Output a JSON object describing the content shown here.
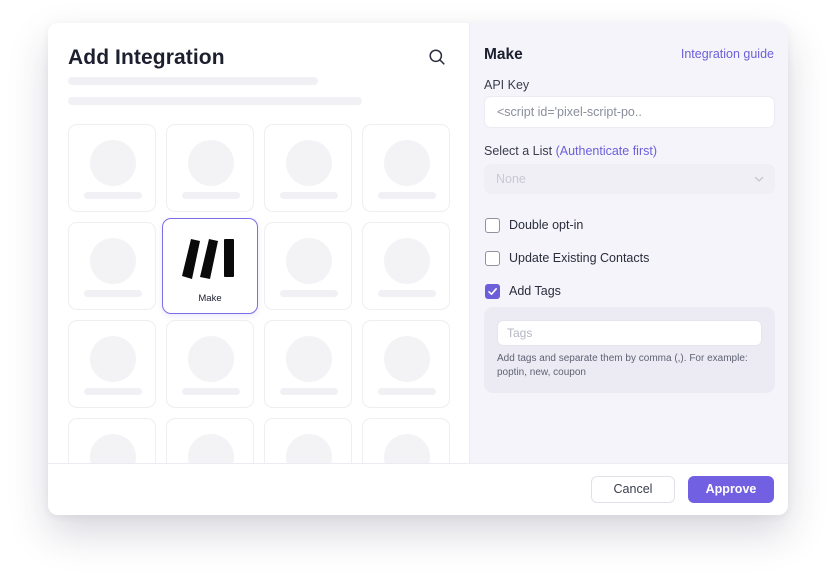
{
  "left_pane": {
    "title": "Add Integration",
    "icons": {
      "search": "search-icon"
    },
    "selected_card": {
      "label": "Make",
      "icon": "make-logo-icon"
    }
  },
  "right_pane": {
    "title": "Make",
    "guide_link": "Integration guide",
    "api_key": {
      "label": "API Key",
      "value": "<script id='pixel-script-po.."
    },
    "list": {
      "label": "Select a List",
      "hint": "(Authenticate first)",
      "selected": "None",
      "icon": "chevron-down-icon"
    },
    "checkboxes": [
      {
        "label": "Double opt-in",
        "checked": false
      },
      {
        "label": "Update Existing Contacts",
        "checked": false
      },
      {
        "label": "Add Tags",
        "checked": true
      }
    ],
    "tags": {
      "placeholder": "Tags",
      "help": "Add tags and separate them by comma (,). For example: poptin, new, coupon"
    }
  },
  "footer": {
    "cancel_label": "Cancel",
    "approve_label": "Approve"
  },
  "colors": {
    "accent": "#7260e3",
    "link": "#6c5fd9",
    "right_pane_bg": "#f5f4fa"
  }
}
